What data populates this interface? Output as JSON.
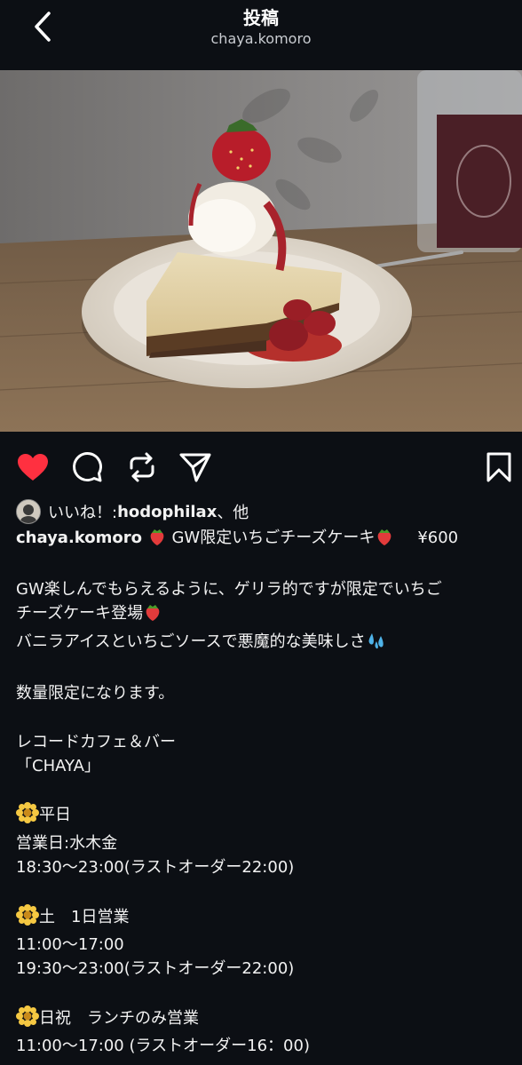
{
  "header": {
    "title": "投稿",
    "username": "chaya.komoro"
  },
  "likes": {
    "prefix": "いいね！: ",
    "liker": "hodophilax",
    "suffix": "、他"
  },
  "caption": {
    "username": "chaya.komoro",
    "title_text": " GW限定いちごチーズケーキ",
    "price": "¥600"
  },
  "body": {
    "line1": "GW楽しんでもらえるように、ゲリラ的ですが限定でいちご",
    "line2": "チーズケーキ登場",
    "line3": "バニラアイスといちごソースで悪魔的な美味しさ",
    "line4": "数量限定になります。",
    "line5": "レコードカフェ＆バー",
    "line6": "「CHAYA」",
    "weekday_title": "平日",
    "weekday_days": "営業日:水木金",
    "weekday_hours": "18:30〜23:00(ラストオーダー22:00)",
    "sat_title": "土　1日営業",
    "sat_hours1": "11:00〜17:00",
    "sat_hours2": "19:30〜23:00(ラストオーダー22:00)",
    "hol_title": "日祝　ランチのみ営業",
    "hol_hours": "11:00〜17:00 (ラストオーダー16：00)"
  },
  "colors": {
    "background": "#0c0f14",
    "like_red": "#ff3040",
    "text": "#f2f2f2"
  },
  "icons": [
    "back-chevron-icon",
    "heart-icon",
    "comment-icon",
    "repost-icon",
    "share-icon",
    "bookmark-icon",
    "strawberry-icon",
    "sweat-droplets-icon",
    "flower-icon"
  ]
}
